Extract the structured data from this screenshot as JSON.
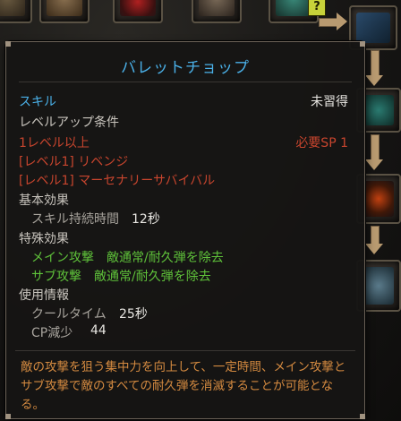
{
  "tooltip": {
    "title": "バレットチョップ",
    "skill_label": "スキル",
    "status": "未習得",
    "req_header": "レベルアップ条件",
    "req_level": "1レベル以上",
    "req_sp": "必要SP 1",
    "req_skills": [
      "[レベル1] リベンジ",
      "[レベル1] マーセナリーサバイバル"
    ],
    "basic_header": "基本効果",
    "basic_effects": [
      {
        "label": "スキル持続時間",
        "value": "12秒"
      }
    ],
    "special_header": "特殊効果",
    "special_effects": [
      "メイン攻撃　敵通常/耐久弾を除去",
      "サブ攻撃　敵通常/耐久弾を除去"
    ],
    "usage_header": "使用情報",
    "usage_info": [
      {
        "label": "クールタイム",
        "value": "25秒"
      },
      {
        "label": "CP減少",
        "value": "44"
      }
    ],
    "description": "敵の攻撃を狙う集中力を向上して、一定時間、メイン攻撃とサブ攻撃で敵のすべての耐久弾を消滅することが可能となる。"
  },
  "skill_tree": {
    "locked_badge": "?"
  },
  "colors": {
    "title": "#4ab0e8",
    "requirement_unmet": "#c8452e",
    "special_effect": "#5fc23a",
    "description": "#d48a40"
  }
}
